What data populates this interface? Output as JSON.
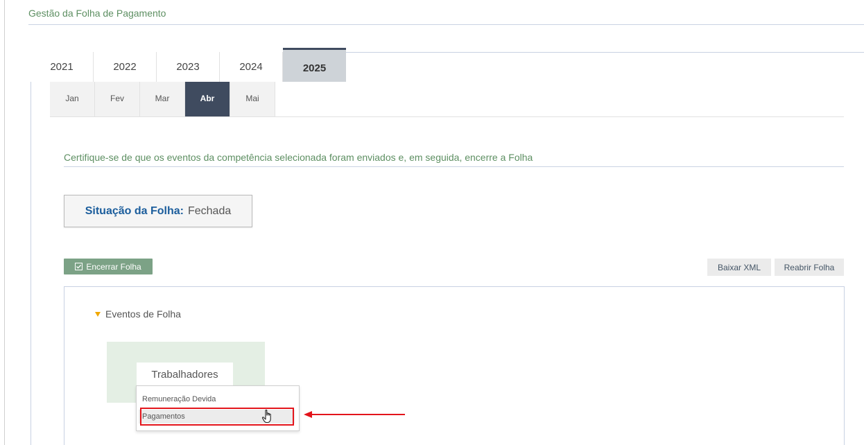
{
  "page": {
    "title": "Gestão da Folha de Pagamento"
  },
  "years": [
    "2021",
    "2022",
    "2023",
    "2024",
    "2025"
  ],
  "selected_year": "2025",
  "months": [
    "Jan",
    "Fev",
    "Mar",
    "Abr",
    "Mai"
  ],
  "selected_month": "Abr",
  "instruction": "Certifique-se de que os eventos da competência selecionada foram enviados e, em seguida, encerre a Folha",
  "status": {
    "label": "Situação da Folha:",
    "value": "Fechada"
  },
  "actions": {
    "encerrar_label": "Encerrar Folha",
    "baixar_label": "Baixar XML",
    "reabrir_label": "Reabrir Folha"
  },
  "events": {
    "section_title": "Eventos de Folha",
    "card_label": "Trabalhadores",
    "menu": [
      "Remuneração Devida",
      "Pagamentos"
    ]
  },
  "colors": {
    "accent_green": "#7ca286",
    "title_green": "#5d8f62",
    "dark_tab": "#3f4b5f",
    "highlight_red": "#e3141b",
    "triangle": "#f0a800"
  }
}
